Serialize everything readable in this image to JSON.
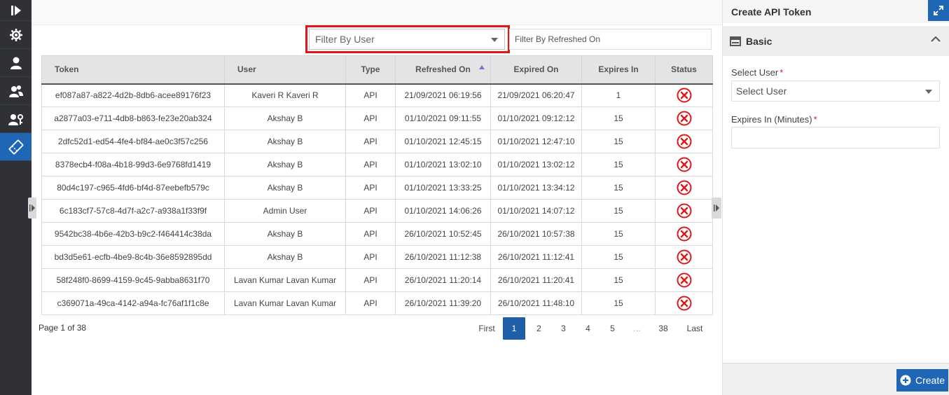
{
  "nav": {
    "items": [
      {
        "icon": "collapse-rail-icon"
      },
      {
        "icon": "gear-icon"
      },
      {
        "icon": "user-icon"
      },
      {
        "icon": "users-group-icon"
      },
      {
        "icon": "user-key-icon"
      },
      {
        "icon": "ticket-icon"
      }
    ]
  },
  "filters": {
    "user_placeholder": "Filter By User",
    "refreshed_placeholder": "Filter By Refreshed On"
  },
  "table": {
    "headers": {
      "token": "Token",
      "user": "User",
      "type": "Type",
      "refreshed": "Refreshed On",
      "expired": "Expired On",
      "expires_in": "Expires In",
      "status": "Status"
    },
    "rows": [
      {
        "token": "ef087a87-a822-4d2b-8db6-acee89176f23",
        "user": "Kaveri R Kaveri R",
        "type": "API",
        "refreshed": "21/09/2021 06:19:56",
        "expired": "21/09/2021 06:20:47",
        "expires_in": "1"
      },
      {
        "token": "a2877a03-e711-4db8-b863-fe23e20ab324",
        "user": "Akshay B",
        "type": "API",
        "refreshed": "01/10/2021 09:11:55",
        "expired": "01/10/2021 09:12:12",
        "expires_in": "15"
      },
      {
        "token": "2dfc52d1-ed54-4fe4-bf84-ae0c3f57c256",
        "user": "Akshay B",
        "type": "API",
        "refreshed": "01/10/2021 12:45:15",
        "expired": "01/10/2021 12:47:10",
        "expires_in": "15"
      },
      {
        "token": "8378ecb4-f08a-4b18-99d3-6e9768fd1419",
        "user": "Akshay B",
        "type": "API",
        "refreshed": "01/10/2021 13:02:10",
        "expired": "01/10/2021 13:02:12",
        "expires_in": "15"
      },
      {
        "token": "80d4c197-c965-4fd6-bf4d-87eebefb579c",
        "user": "Akshay B",
        "type": "API",
        "refreshed": "01/10/2021 13:33:25",
        "expired": "01/10/2021 13:34:12",
        "expires_in": "15"
      },
      {
        "token": "6c183cf7-57c8-4d7f-a2c7-a938a1f33f9f",
        "user": "Admin User",
        "type": "API",
        "refreshed": "01/10/2021 14:06:26",
        "expired": "01/10/2021 14:07:12",
        "expires_in": "15"
      },
      {
        "token": "9542bc38-4b6e-42b3-b9c2-f464414c38da",
        "user": "Akshay B",
        "type": "API",
        "refreshed": "26/10/2021 10:52:45",
        "expired": "26/10/2021 10:57:38",
        "expires_in": "15"
      },
      {
        "token": "bd3d5e61-ecfb-4be9-8c4b-36e8592895dd",
        "user": "Akshay B",
        "type": "API",
        "refreshed": "26/10/2021 11:12:38",
        "expired": "26/10/2021 11:12:41",
        "expires_in": "15"
      },
      {
        "token": "58f248f0-8699-4159-9c45-9abba8631f70",
        "user": "Lavan Kumar Lavan Kumar",
        "type": "API",
        "refreshed": "26/10/2021 11:20:14",
        "expired": "26/10/2021 11:20:41",
        "expires_in": "15"
      },
      {
        "token": "c369071a-49ca-4142-a94a-fc76af1f1c8e",
        "user": "Lavan Kumar Lavan Kumar",
        "type": "API",
        "refreshed": "26/10/2021 11:39:20",
        "expired": "26/10/2021 11:48:10",
        "expires_in": "15"
      }
    ]
  },
  "pagination": {
    "info": "Page 1 of 38",
    "first": "First",
    "pages": [
      "1",
      "2",
      "3",
      "4",
      "5"
    ],
    "ellipsis": "…",
    "last_page": "38",
    "last": "Last",
    "current": "1"
  },
  "panel": {
    "title": "Create API Token",
    "section": "Basic",
    "select_user_label": "Select User",
    "select_user_placeholder": "Select User",
    "expires_label": "Expires In (Minutes)",
    "required_mark": "*",
    "create_label": "Create"
  },
  "colors": {
    "accent": "#1f66b5",
    "highlight": "#e0161a",
    "status_revoked": "#e0161a"
  }
}
